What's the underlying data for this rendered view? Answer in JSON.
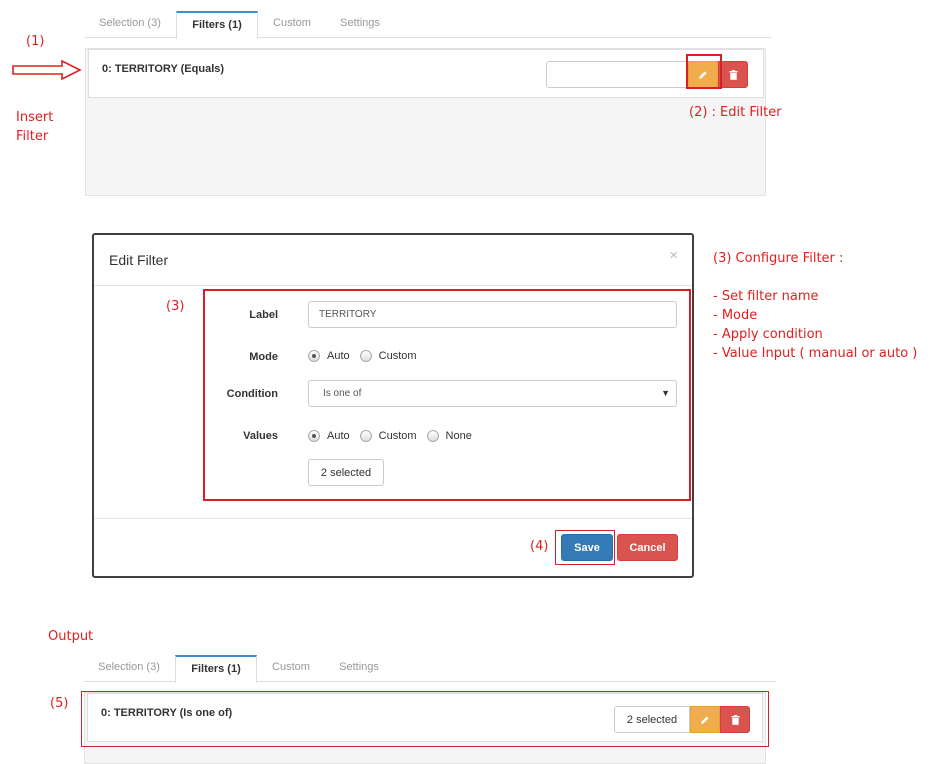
{
  "annotations": {
    "step1": "(1)",
    "insert_filter": [
      "Insert",
      "Filter"
    ],
    "step2": "(2) : Edit Filter",
    "step3_left": "(3)",
    "step3_title": "(3) Configure Filter :",
    "step3_items": [
      "- Set filter name",
      "- Mode",
      "- Apply condition",
      "- Value Input ( manual or auto )"
    ],
    "step4": "(4)",
    "output": "Output",
    "step5": "(5)"
  },
  "tabs": [
    "Selection (3)",
    "Filters (1)",
    "Custom",
    "Settings"
  ],
  "active_tab_index": 1,
  "top_panel": {
    "filter_title": "0: TERRITORY (Equals)",
    "input_value": ""
  },
  "modal": {
    "title": "Edit Filter",
    "close": "×",
    "label_field": {
      "label": "Label",
      "value": "TERRITORY"
    },
    "mode": {
      "label": "Mode",
      "options": [
        "Auto",
        "Custom"
      ],
      "selected": "Auto"
    },
    "condition": {
      "label": "Condition",
      "value": "Is one of"
    },
    "values": {
      "label": "Values",
      "options": [
        "Auto",
        "Custom",
        "None"
      ],
      "selected": "Auto",
      "button": "2 selected"
    },
    "save": "Save",
    "cancel": "Cancel"
  },
  "bottom_panel": {
    "filter_title": "0: TERRITORY (Is one of)",
    "selected_button": "2 selected"
  },
  "colors": {
    "annotation_red": "#e0201f",
    "tab_active_border": "#3a8fd0",
    "edit_button": "#f0ad4e",
    "delete_button": "#d9534f",
    "save_button": "#337ab7",
    "cancel_button": "#d9534f"
  },
  "icons": {
    "arrow": "right-arrow-icon",
    "edit": "pencil-icon",
    "delete": "trash-icon",
    "caret": "caret-down-icon"
  }
}
